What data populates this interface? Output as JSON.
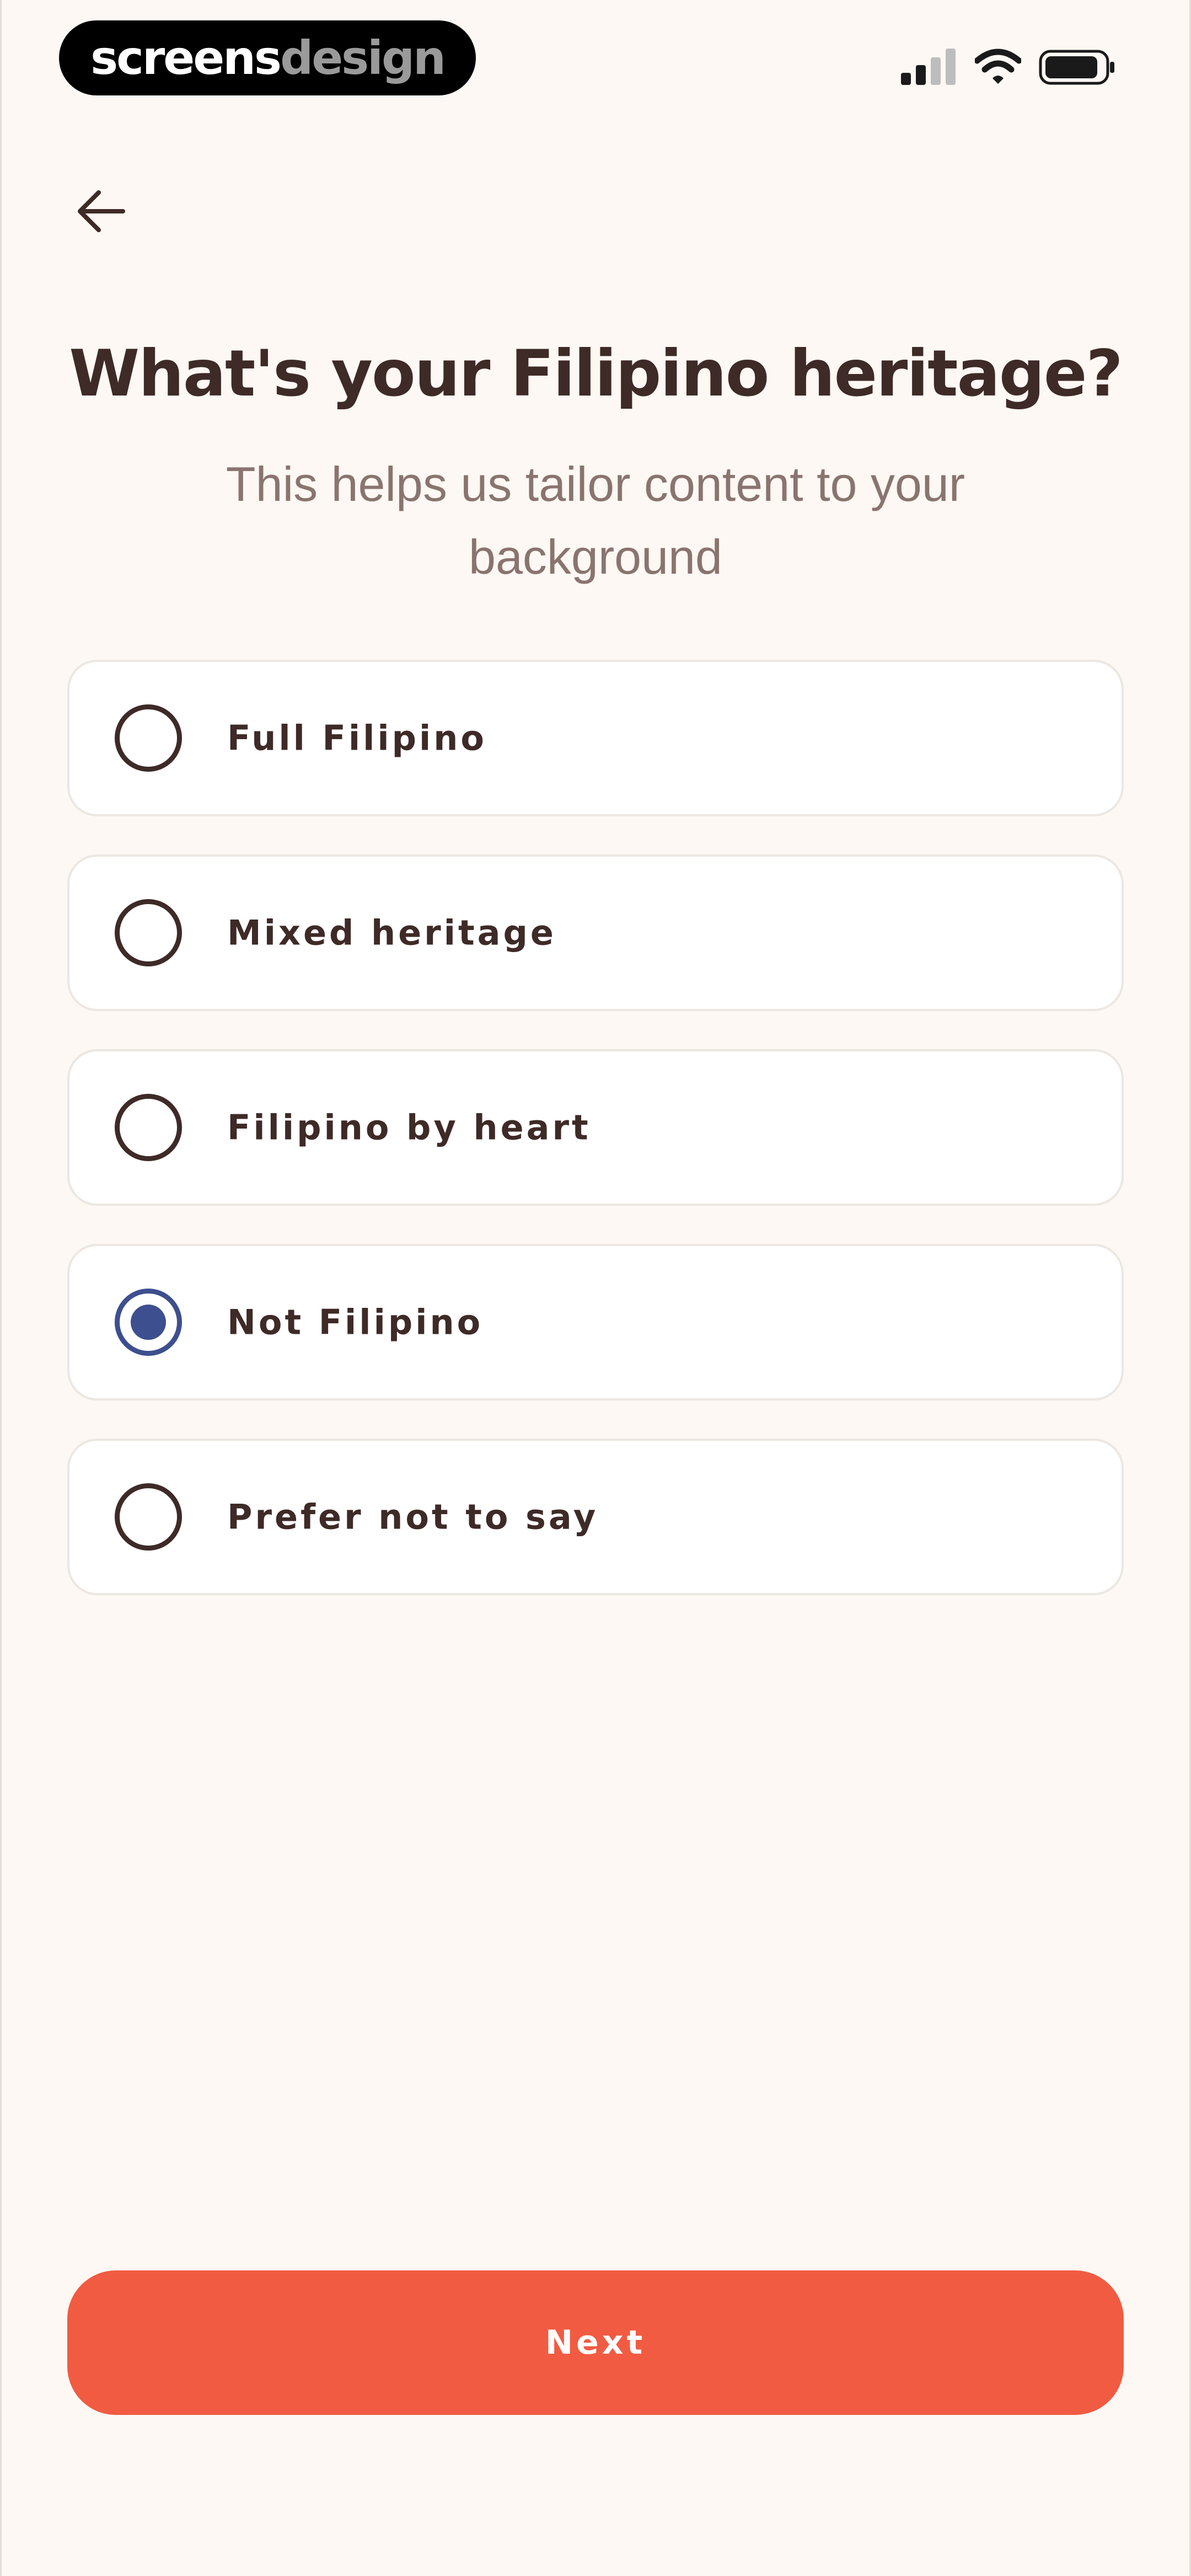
{
  "brand": {
    "part_a": "screens",
    "part_b": "design"
  },
  "status_bar": {
    "icons": [
      "signal-icon",
      "wifi-icon",
      "battery-icon"
    ]
  },
  "nav": {
    "back_icon": "arrow-left-icon"
  },
  "header": {
    "title": "What's your Filipino heritage?",
    "subtitle": "This helps us tailor content to your background"
  },
  "options": [
    {
      "label": "Full Filipino",
      "selected": false
    },
    {
      "label": "Mixed heritage",
      "selected": false
    },
    {
      "label": "Filipino by heart",
      "selected": false
    },
    {
      "label": "Not Filipino",
      "selected": true
    },
    {
      "label": "Prefer not to say",
      "selected": false
    }
  ],
  "footer": {
    "next_label": "Next"
  },
  "colors": {
    "background": "#fdf8f3",
    "text": "#3e2a27",
    "subtitle": "#8a7470",
    "accent": "#f15b42",
    "radio_selected": "#3d4f8e",
    "card_border": "#ece7e1"
  }
}
